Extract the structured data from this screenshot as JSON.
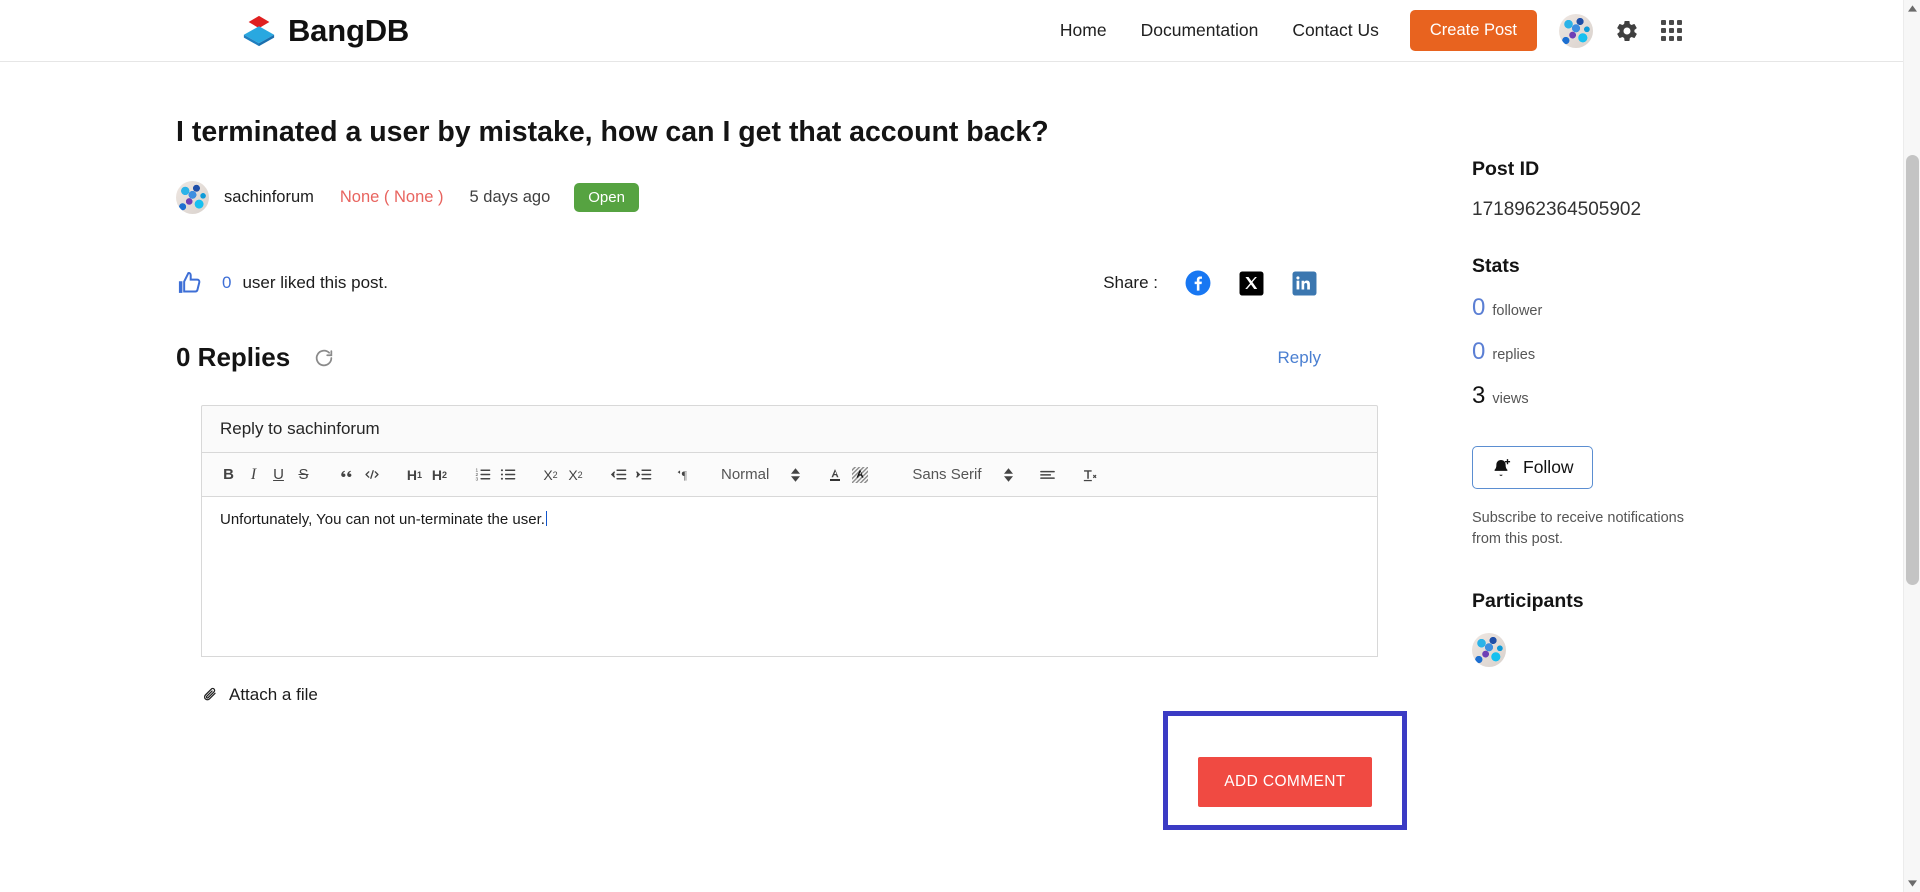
{
  "navbar": {
    "brand": "BangDB",
    "brand_logo_icon": "bangdb-cube-logo",
    "links": [
      {
        "label": "Home",
        "name": "nav-link-home"
      },
      {
        "label": "Documentation",
        "name": "nav-link-documentation"
      },
      {
        "label": "Contact Us",
        "name": "nav-link-contact-us"
      }
    ],
    "create_post_label": "Create Post",
    "create_post_color": "#e8631f",
    "avatar_icon": "user-avatar",
    "settings_icon": "gear-icon",
    "apps_icon": "grid-apps-icon"
  },
  "post": {
    "title": "I terminated a user by mistake, how can I get that account back?",
    "author": "sachinforum",
    "author_avatar_icon": "user-avatar",
    "category": "None ( None )",
    "category_color": "#e8645f",
    "time": "5 days ago",
    "status": "Open",
    "status_color": "#56a341"
  },
  "likes": {
    "thumb_icon": "thumbs-up-icon",
    "count": "0",
    "text": "user liked this post.",
    "count_color": "#3e6fd6"
  },
  "share": {
    "label": "Share :",
    "icons": [
      {
        "name": "facebook-icon",
        "color": "#1877f2"
      },
      {
        "name": "x-twitter-icon",
        "color": "#000000"
      },
      {
        "name": "linkedin-icon",
        "color": "#0a66c2"
      }
    ]
  },
  "replies": {
    "heading": "0 Replies",
    "refresh_icon": "refresh-icon",
    "reply_link": "Reply"
  },
  "editor": {
    "reply_to_placeholder": "Reply to sachinforum",
    "body_text": "Unfortunately, You can not un-terminate the user.",
    "toolbar": {
      "bold": "B",
      "italic": "I",
      "underline": "U",
      "strike": "S",
      "blockquote_icon": "blockquote-icon",
      "code_icon": "code-icon",
      "h1": "H",
      "h1_sub": "1",
      "h2": "H",
      "h2_sub": "2",
      "ordered_list_icon": "ordered-list-icon",
      "bullet_list_icon": "bullet-list-icon",
      "subscript": "X",
      "subscript_sub": "2",
      "superscript": "X",
      "superscript_sup": "2",
      "outdent_icon": "outdent-icon",
      "indent_icon": "indent-icon",
      "direction_icon": "text-direction-icon",
      "format_value": "Normal",
      "font_color_icon": "font-color-icon",
      "highlight_color_icon": "background-color-icon",
      "font_value": "Sans Serif",
      "align_icon": "align-left-icon",
      "clear_format_icon": "clear-formatting-icon"
    }
  },
  "attach": {
    "icon": "paperclip-icon",
    "label": "Attach a file"
  },
  "action": {
    "add_comment_label": "ADD COMMENT",
    "add_comment_color": "#f04a42",
    "highlight_color": "#3b3bc4"
  },
  "sidebar": {
    "post_id_heading": "Post ID",
    "post_id_value": "1718962364505902",
    "stats_heading": "Stats",
    "stats": [
      {
        "value": "0",
        "label": "follower",
        "color": "#5b7fd4"
      },
      {
        "value": "0",
        "label": "replies",
        "color": "#5b7fd4"
      },
      {
        "value": "3",
        "label": "views",
        "color": "#111111"
      }
    ],
    "follow_label": "Follow",
    "follow_icon": "bell-plus-icon",
    "follow_note": "Subscribe to receive notifications from this post.",
    "participants_heading": "Participants",
    "participant_avatar_icon": "user-avatar"
  },
  "scrollbar": {
    "up_icon": "chevron-up-icon",
    "down_icon": "chevron-down-icon"
  }
}
